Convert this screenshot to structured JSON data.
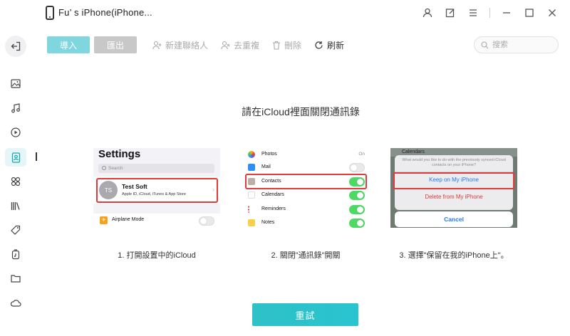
{
  "titlebar": {
    "device_name": "Fu’ s iPhone(iPhone..."
  },
  "toolbar": {
    "import_label": "導入",
    "export_label": "匯出",
    "new_contact_label": "新建聯絡人",
    "dedupe_label": "去重複",
    "delete_label": "刪除",
    "refresh_label": "刷新"
  },
  "search": {
    "placeholder": "搜索"
  },
  "main": {
    "heading": "請在iCloud裡面關閉通訊錄",
    "steps": [
      {
        "caption": "1. 打開設置中的iCloud",
        "image": {
          "title": "Settings",
          "search_placeholder": "Search",
          "avatar_initials": "TS",
          "profile_name": "Test Soft",
          "profile_sub": "Apple ID, iCloud, iTunes & App Store",
          "airplane_label": "Airplane Mode"
        }
      },
      {
        "caption": "2. 關閉\"通訊錄\"開關",
        "image": {
          "rows": [
            {
              "label": "Photos",
              "value": "On"
            },
            {
              "label": "Mail",
              "value": ""
            },
            {
              "label": "Contacts",
              "value": ""
            },
            {
              "label": "Calendars",
              "value": ""
            },
            {
              "label": "Reminders",
              "value": ""
            },
            {
              "label": "Notes",
              "value": ""
            }
          ]
        }
      },
      {
        "caption": "3. 選擇\"保留在我的iPhone上\"。",
        "image": {
          "bg_label": "Calendars",
          "message": "What would you like to do with the previously synced iCloud contacts on your iPhone?",
          "keep_label": "Keep on My iPhone",
          "delete_label": "Delete from My iPhone",
          "cancel_label": "Cancel"
        }
      }
    ],
    "retry_label": "重試"
  },
  "colors": {
    "accent": "#2ec1c8",
    "highlight": "#e03a3a",
    "toggle_on": "#4cd964"
  },
  "sidebar_icons": [
    "exit-icon",
    "photo-icon",
    "music-icon",
    "video-icon",
    "contacts-icon",
    "apps-icon",
    "books-icon",
    "tag-icon",
    "ringtone-icon",
    "folder-icon",
    "cloud-icon"
  ]
}
